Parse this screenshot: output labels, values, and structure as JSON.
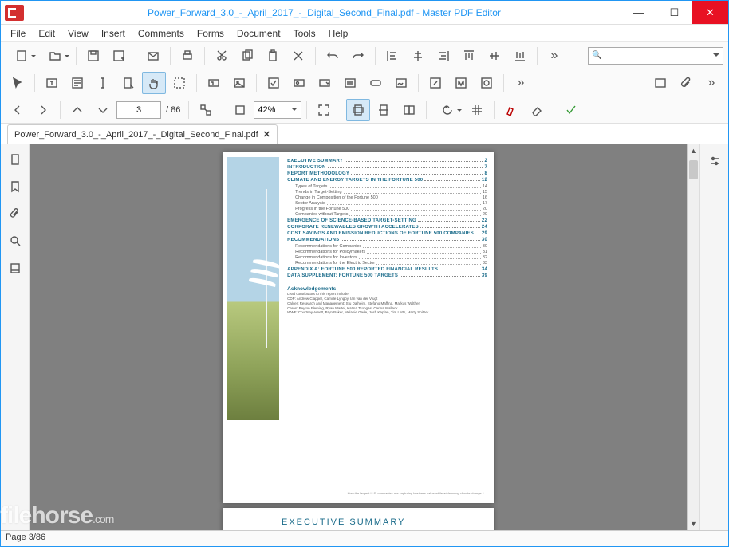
{
  "window": {
    "title": "Power_Forward_3.0_-_April_2017_-_Digital_Second_Final.pdf - Master PDF Editor"
  },
  "menu": {
    "items": [
      "File",
      "Edit",
      "View",
      "Insert",
      "Comments",
      "Forms",
      "Document",
      "Tools",
      "Help"
    ]
  },
  "nav": {
    "page_current": "3",
    "page_total": "/ 86",
    "zoom": "42%"
  },
  "tab": {
    "label": "Power_Forward_3.0_-_April_2017_-_Digital_Second_Final.pdf"
  },
  "status": {
    "text": "Page 3/86"
  },
  "doc": {
    "exec_header": "EXECUTIVE SUMMARY",
    "toc": [
      {
        "type": "h",
        "t": "EXECUTIVE SUMMARY",
        "p": "2"
      },
      {
        "type": "h",
        "t": "INTRODUCTION",
        "p": "7"
      },
      {
        "type": "h",
        "t": "REPORT METHODOLOGY",
        "p": "8"
      },
      {
        "type": "h",
        "t": "CLIMATE AND ENERGY TARGETS IN THE FORTUNE 500",
        "p": "12"
      },
      {
        "type": "s",
        "t": "Types of Targets",
        "p": "14"
      },
      {
        "type": "s",
        "t": "Trends in Target-Setting",
        "p": "15"
      },
      {
        "type": "s",
        "t": "Change in Composition of the Fortune 500",
        "p": "16"
      },
      {
        "type": "s",
        "t": "Sector Analysis",
        "p": "17"
      },
      {
        "type": "s",
        "t": "Progress in the Fortune 500",
        "p": "20"
      },
      {
        "type": "s",
        "t": "Companies without Targets",
        "p": "20"
      },
      {
        "type": "h",
        "t": "EMERGENCE OF SCIENCE-BASED TARGET-SETTING",
        "p": "22"
      },
      {
        "type": "h",
        "t": "CORPORATE RENEWABLES GROWTH ACCELERATES",
        "p": "24"
      },
      {
        "type": "h",
        "t": "COST SAVINGS AND EMISSION REDUCTIONS OF FORTUNE 500 COMPANIES",
        "p": "29"
      },
      {
        "type": "h",
        "t": "RECOMMENDATIONS",
        "p": "30"
      },
      {
        "type": "s",
        "t": "Recommendations for Companies",
        "p": "30"
      },
      {
        "type": "s",
        "t": "Recommendations for Policymakers",
        "p": "31"
      },
      {
        "type": "s",
        "t": "Recommendations for Investors",
        "p": "32"
      },
      {
        "type": "s",
        "t": "Recommendations for the Electric Sector",
        "p": "33"
      },
      {
        "type": "h",
        "t": "APPENDIX A: FORTUNE 500 REPORTED FINANCIAL RESULTS",
        "p": "34"
      },
      {
        "type": "h",
        "t": "DATA SUPPLEMENT: FORTUNE 500 TARGETS",
        "p": "39"
      }
    ],
    "ack": {
      "title": "Acknowledgements",
      "lines": [
        "Lead contributors to this report include:",
        "CDP: Andrew Clapper, Camille Lyngby, Ian van der Vlugt",
        "Calvert Research and Management: Stu Dalheim, Stefano Maffina, Markus Walther",
        "Ceres: Peyton Fleming, Ryan Martel, Katina Tsongas, Carina Wallack",
        "WWF: Courtney Arnett, Bryn Baker, Melanie Gade, Josh Kaplan, Tim Letts, Marty Spitzer"
      ]
    },
    "footer_text": "How the largest U.S. companies are capturing business value while addressing climate change   1"
  },
  "watermark": {
    "brand": "filehorse",
    "ext": ".com"
  }
}
